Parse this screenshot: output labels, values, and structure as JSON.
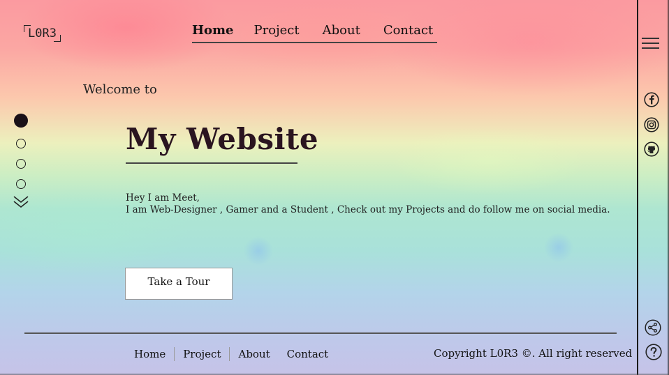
{
  "logo": {
    "text": "L0R3"
  },
  "topnav": {
    "home": "Home",
    "project": "Project",
    "about": "About",
    "contact": "Contact"
  },
  "hero": {
    "welcome": "Welcome to",
    "title": "My Website",
    "line1": "Hey I am Meet,",
    "line2": "I am Web-Designer , Gamer and a Student , Check out my Projects and do follow me on social media.",
    "button": "Take a Tour"
  },
  "footer": {
    "home": "Home",
    "project": "Project",
    "about": "About",
    "contact": "Contact",
    "copyright": "Copyright L0R3 ©. All right reserved"
  },
  "icons": {
    "menu": "hamburger-icon",
    "facebook": "facebook-icon",
    "instagram": "instagram-icon",
    "github": "github-icon",
    "share": "share-icon",
    "help": "help-icon",
    "scroll": "chevron-down-icon"
  },
  "colors": {
    "title": "#2a1520",
    "line": "#444444",
    "button_bg": "#ffffff"
  }
}
